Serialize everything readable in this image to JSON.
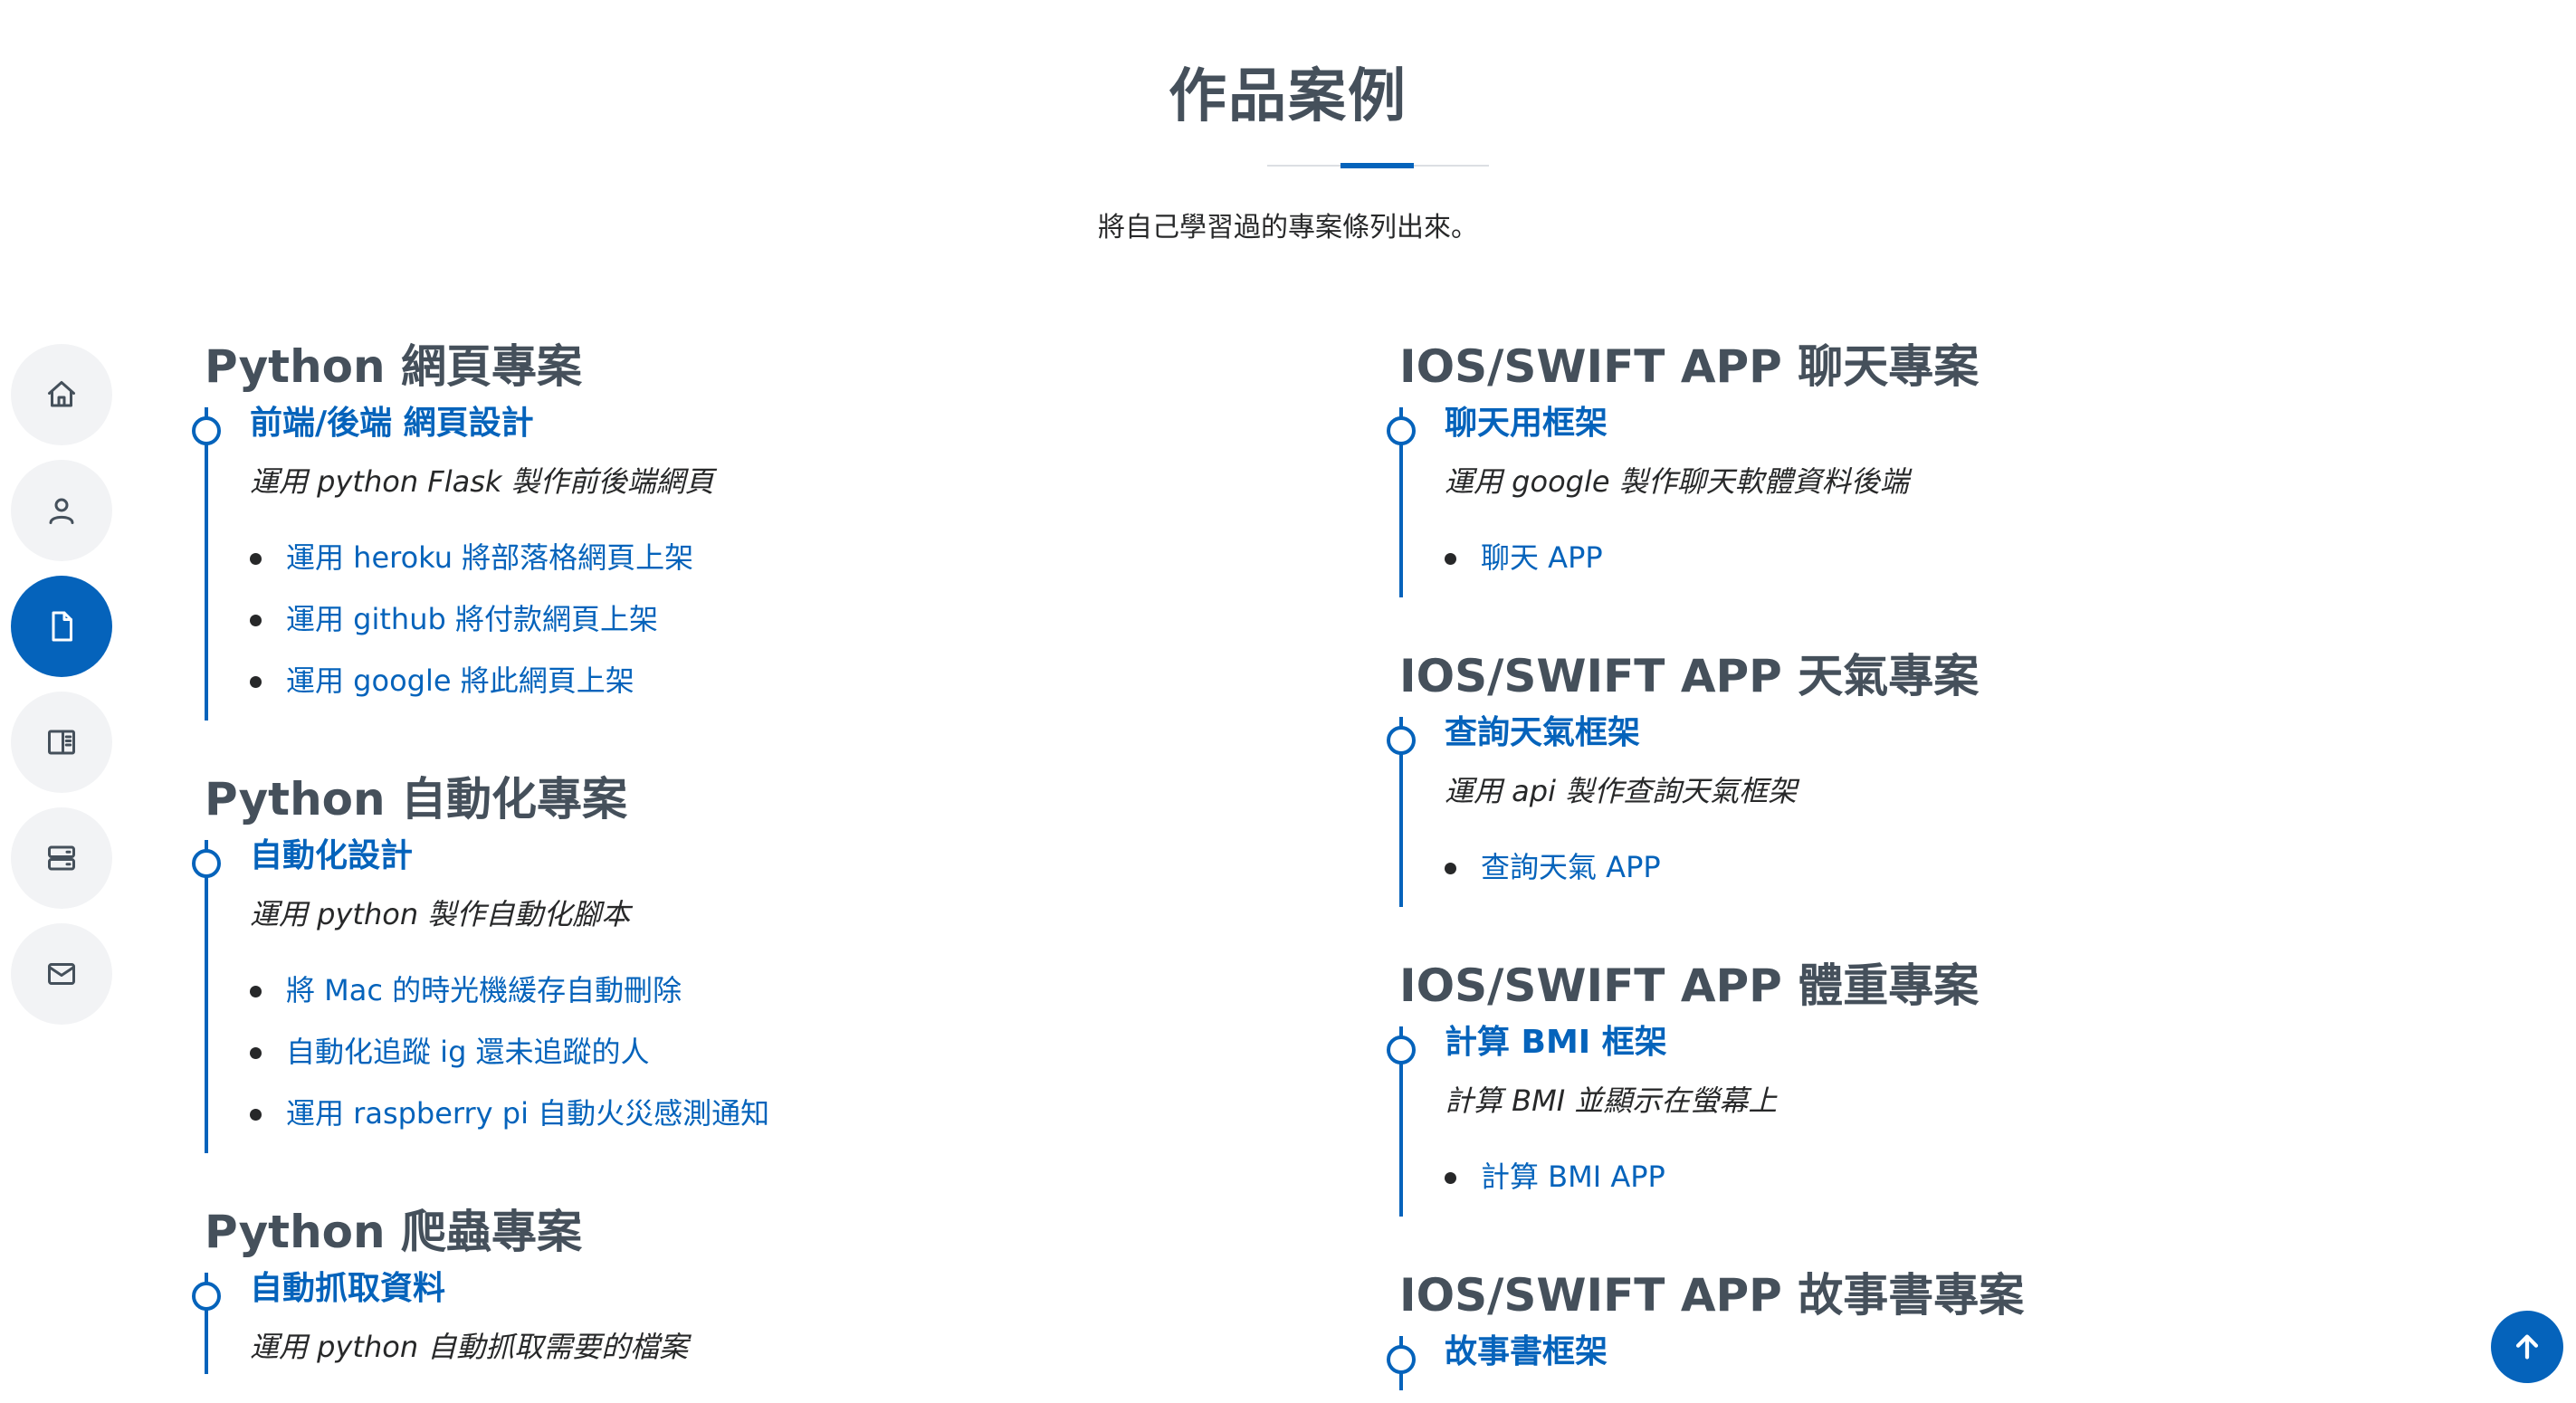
{
  "section": {
    "title": "作品案例",
    "subtitle": "將自己學習過的專案條列出來。"
  },
  "nav": [
    {
      "icon": "home-icon",
      "active": false
    },
    {
      "icon": "person-icon",
      "active": false
    },
    {
      "icon": "file-icon",
      "active": true
    },
    {
      "icon": "book-icon",
      "active": false
    },
    {
      "icon": "server-icon",
      "active": false
    },
    {
      "icon": "envelope-icon",
      "active": false
    }
  ],
  "left_column": [
    {
      "title": "Python 網頁專案",
      "item_title": "前端/後端 網頁設計",
      "item_desc": "運用 python Flask 製作前後端網頁",
      "links": [
        "運用 heroku 將部落格網頁上架",
        "運用 github 將付款網頁上架",
        "運用 google 將此網頁上架"
      ]
    },
    {
      "title": "Python 自動化專案",
      "item_title": "自動化設計",
      "item_desc": "運用 python 製作自動化腳本",
      "links": [
        "將 Mac 的時光機緩存自動刪除",
        "自動化追蹤 ig 還未追蹤的人",
        "運用 raspberry pi 自動火災感測通知"
      ]
    },
    {
      "title": "Python 爬蟲專案",
      "item_title": "自動抓取資料",
      "item_desc": "運用 python 自動抓取需要的檔案",
      "links": []
    }
  ],
  "right_column": [
    {
      "title": "IOS/SWIFT APP 聊天專案",
      "item_title": "聊天用框架",
      "item_desc": "運用 google 製作聊天軟體資料後端",
      "links": [
        "聊天 APP"
      ]
    },
    {
      "title": "IOS/SWIFT APP 天氣專案",
      "item_title": "查詢天氣框架",
      "item_desc": "運用 api 製作查詢天氣框架",
      "links": [
        "查詢天氣 APP"
      ]
    },
    {
      "title": "IOS/SWIFT APP 體重專案",
      "item_title": "計算 BMI 框架",
      "item_desc": "計算 BMI 並顯示在螢幕上",
      "links": [
        "計算 BMI APP"
      ]
    },
    {
      "title": "IOS/SWIFT APP 故事書專案",
      "item_title": "故事書框架",
      "item_desc": "",
      "links": []
    }
  ],
  "colors": {
    "accent": "#0563bb",
    "heading": "#45505b",
    "text": "#272829",
    "nav_bg": "#f2f3f5"
  }
}
